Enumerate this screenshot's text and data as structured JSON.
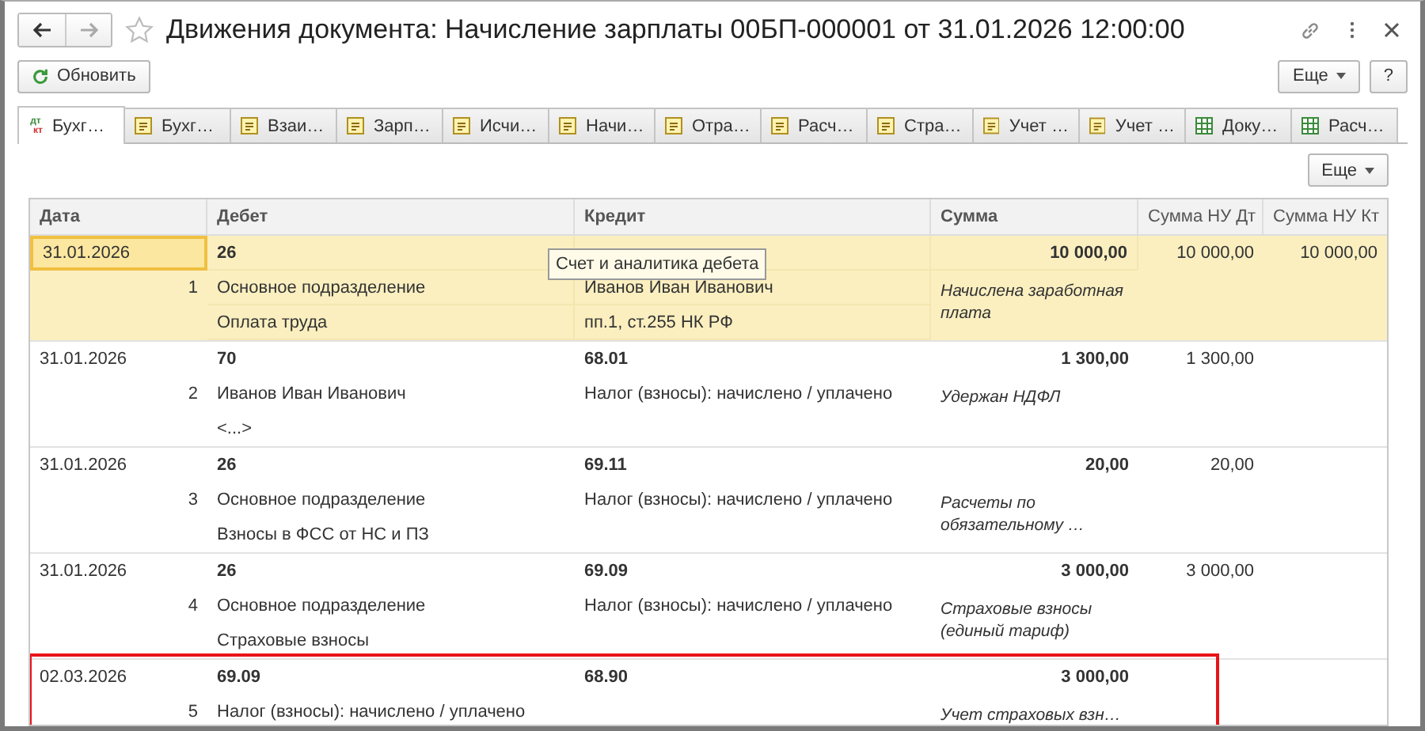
{
  "window": {
    "title": "Движения документа: Начисление зарплаты 00БП-000001 от 31.01.2026 12:00:00"
  },
  "toolbar": {
    "refresh": "Обновить",
    "more": "Еще",
    "help": "?"
  },
  "tabs": [
    {
      "label": "Бухг…",
      "kind": "dtkt",
      "selected": true,
      "icon_text": [
        "дт",
        "кт"
      ]
    },
    {
      "label": "Бухг…",
      "kind": "register",
      "selected": false
    },
    {
      "label": "Взаи…",
      "kind": "register",
      "selected": false
    },
    {
      "label": "Зарп…",
      "kind": "register",
      "selected": false
    },
    {
      "label": "Исчи…",
      "kind": "register",
      "selected": false
    },
    {
      "label": "Начи…",
      "kind": "register",
      "selected": false
    },
    {
      "label": "Отра…",
      "kind": "register",
      "selected": false
    },
    {
      "label": "Расч…",
      "kind": "register",
      "selected": false
    },
    {
      "label": "Стра…",
      "kind": "register",
      "selected": false
    },
    {
      "label": "Учет …",
      "kind": "register",
      "selected": false
    },
    {
      "label": "Учет …",
      "kind": "register",
      "selected": false
    },
    {
      "label": "Доку…",
      "kind": "table",
      "selected": false
    },
    {
      "label": "Расч…",
      "kind": "table",
      "selected": false
    }
  ],
  "table_more": "Еще",
  "table": {
    "columns": [
      "Дата",
      "Дебет",
      "Кредит",
      "Сумма",
      "Сумма НУ Дт",
      "Сумма НУ Кт"
    ],
    "rows": [
      {
        "date": "31.01.2026",
        "number": "1",
        "debit": {
          "account": "26",
          "analytics": [
            "Основное подразделение",
            "Оплата труда"
          ]
        },
        "credit": {
          "analytics": [
            "Иванов Иван Иванович",
            "пп.1, ст.255 НК РФ"
          ]
        },
        "sum": "10 000,00",
        "content": "Начислена заработная плата",
        "sum_nu_dt": "10 000,00",
        "sum_nu_kt": "10 000,00",
        "selected": true,
        "highlighted": false
      },
      {
        "date": "31.01.2026",
        "number": "2",
        "debit": {
          "account": "70",
          "analytics": [
            "Иванов Иван Иванович",
            "<...>"
          ]
        },
        "credit": {
          "account": "68.01",
          "analytics": [
            "Налог (взносы): начислено / уплачено"
          ]
        },
        "sum": "1 300,00",
        "content": "Удержан НДФЛ",
        "sum_nu_dt": "1 300,00",
        "selected": false,
        "highlighted": false
      },
      {
        "date": "31.01.2026",
        "number": "3",
        "debit": {
          "account": "26",
          "analytics": [
            "Основное подразделение",
            "Взносы в ФСС от НС и ПЗ"
          ]
        },
        "credit": {
          "account": "69.11",
          "analytics": [
            "Налог (взносы): начислено / уплачено"
          ]
        },
        "sum": "20,00",
        "content": "Расчеты по обязательному …",
        "sum_nu_dt": "20,00",
        "selected": false,
        "highlighted": false
      },
      {
        "date": "31.01.2026",
        "number": "4",
        "debit": {
          "account": "26",
          "analytics": [
            "Основное подразделение",
            "Страховые взносы"
          ]
        },
        "credit": {
          "account": "69.09",
          "analytics": [
            "Налог (взносы): начислено / уплачено"
          ]
        },
        "sum": "3 000,00",
        "content": "Страховые взносы (единый тариф)",
        "sum_nu_dt": "3 000,00",
        "selected": false,
        "highlighted": false
      },
      {
        "date": "02.03.2026",
        "number": "5",
        "debit": {
          "account": "69.09",
          "analytics": [
            "Налог (взносы): начислено / уплачено"
          ]
        },
        "credit": {
          "account": "68.90"
        },
        "sum": "3 000,00",
        "content": "Учет страховых взн…",
        "selected": false,
        "highlighted": true
      }
    ]
  },
  "tooltip": "Счет и аналитика дебета"
}
